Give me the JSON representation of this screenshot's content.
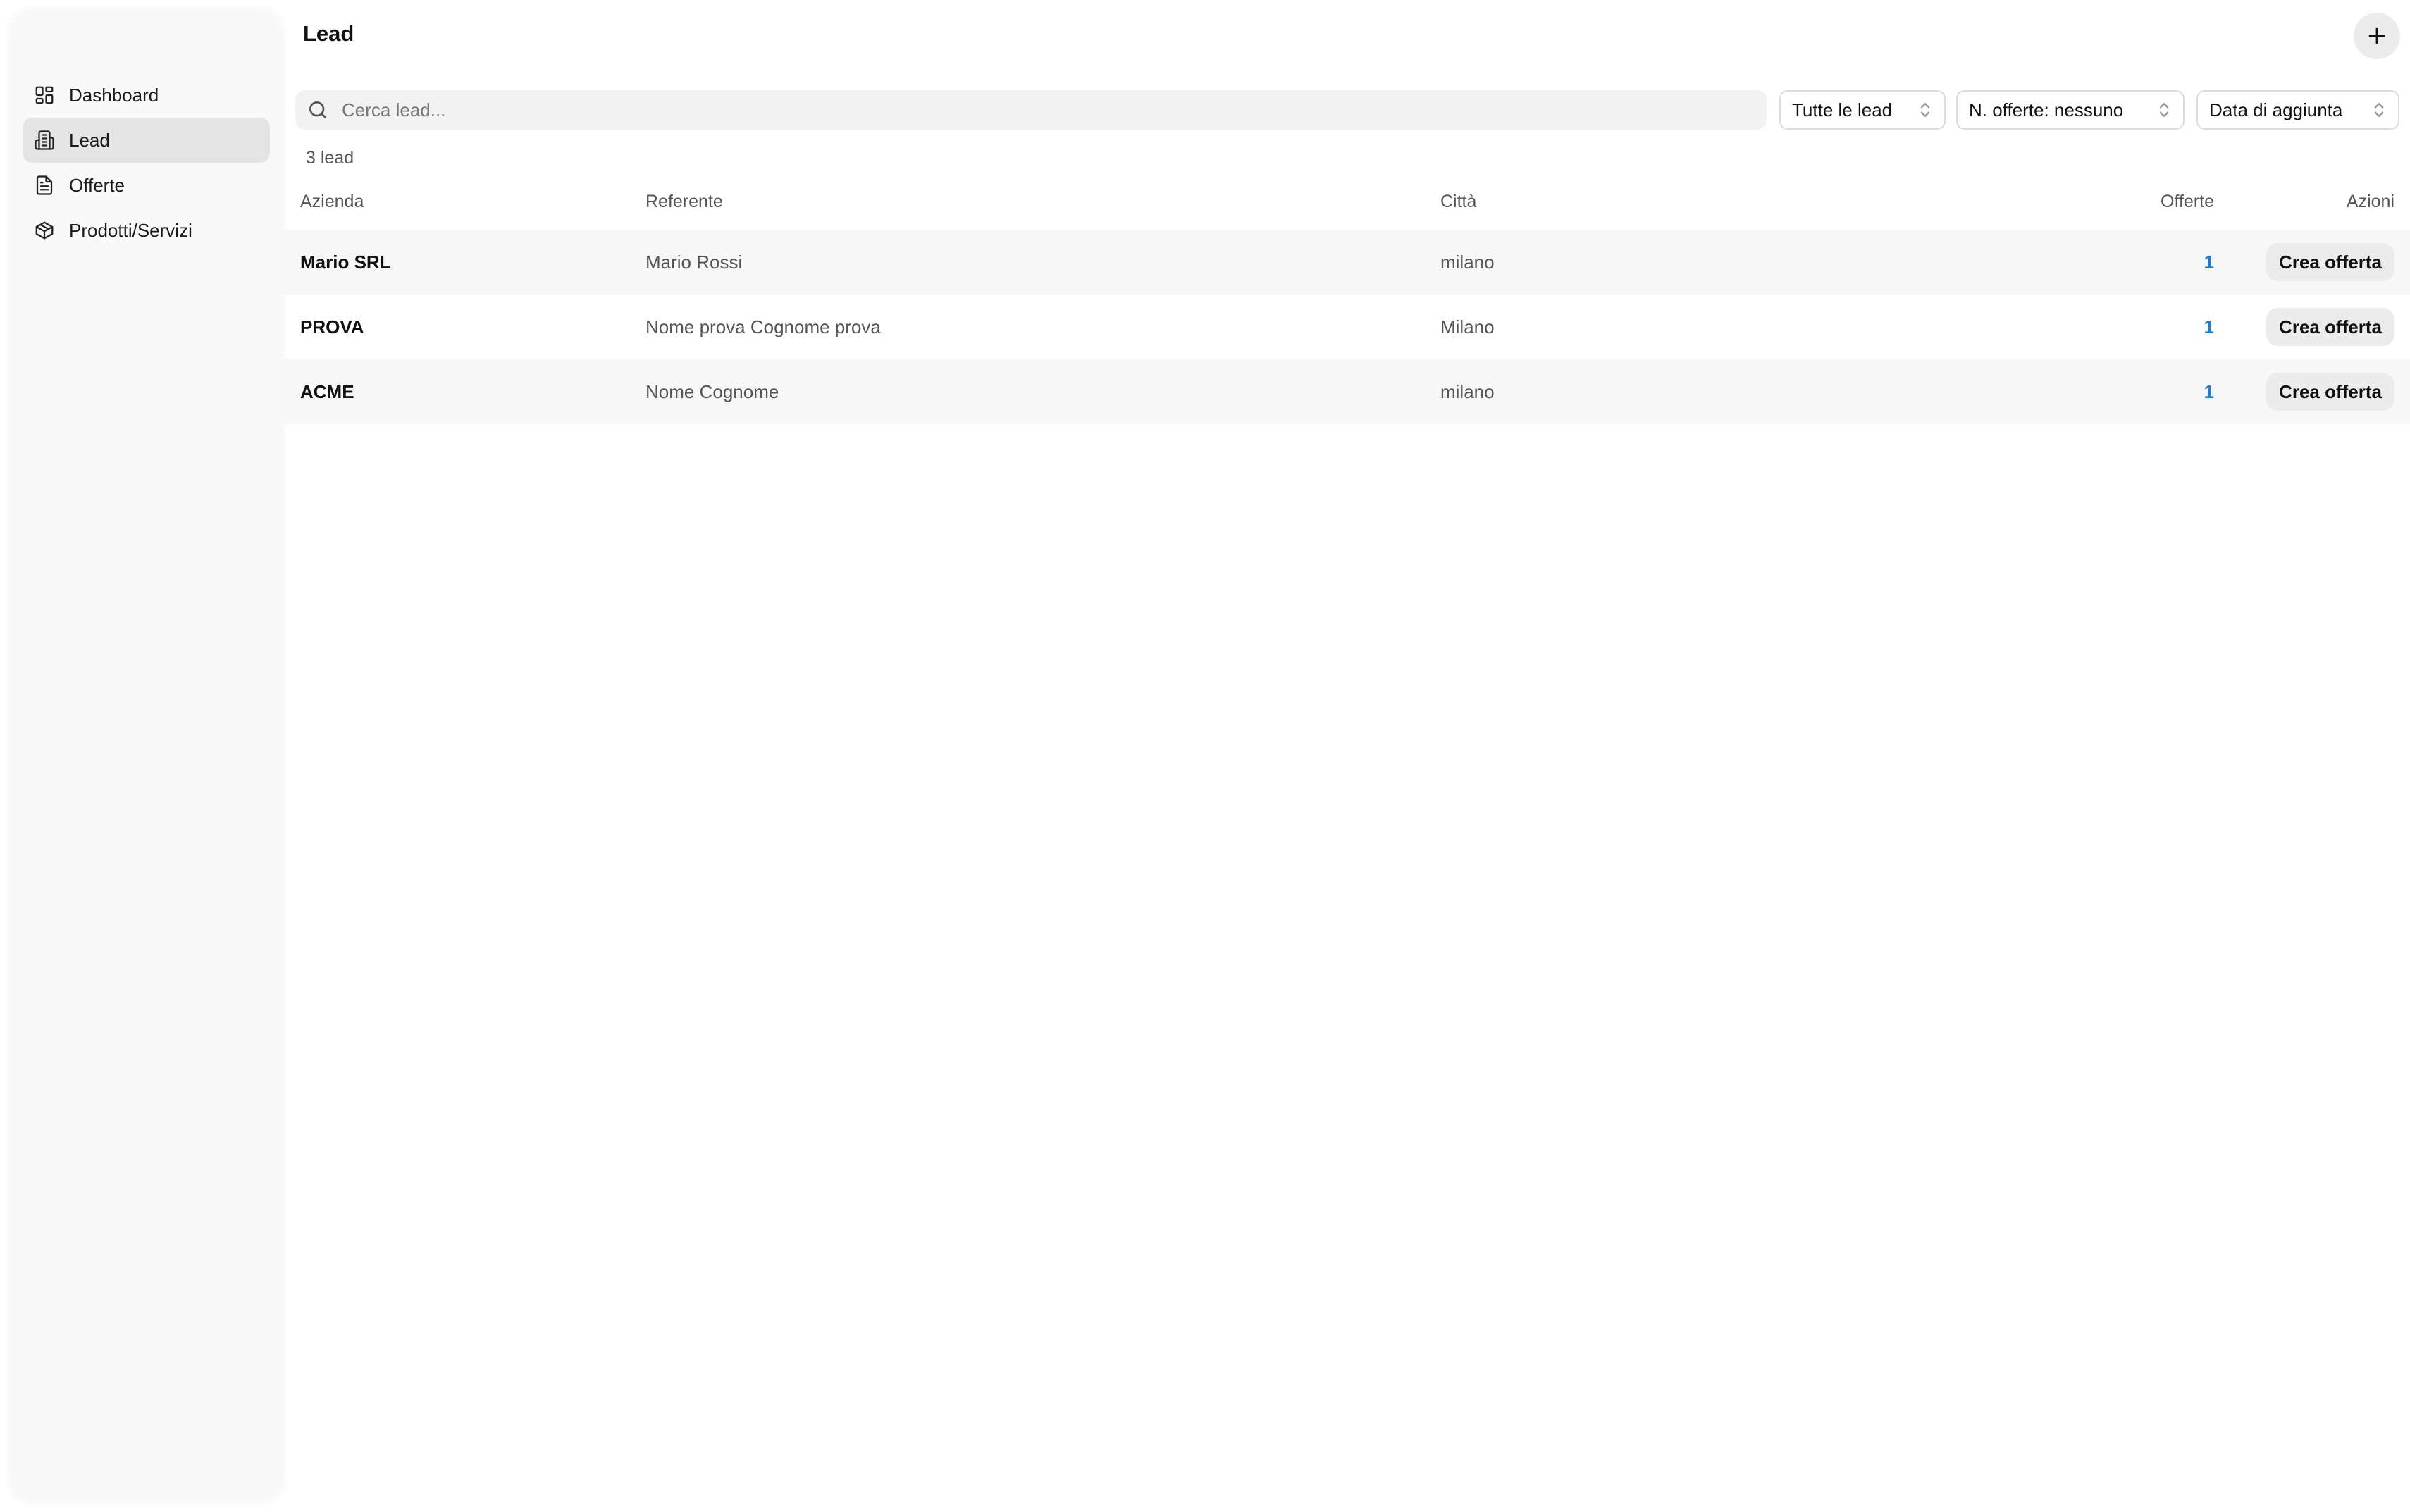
{
  "sidebar": {
    "items": [
      {
        "label": "Dashboard",
        "icon": "dashboard-icon"
      },
      {
        "label": "Lead",
        "icon": "building-icon",
        "active": true
      },
      {
        "label": "Offerte",
        "icon": "document-icon"
      },
      {
        "label": "Prodotti/Servizi",
        "icon": "package-icon"
      }
    ]
  },
  "header": {
    "title": "Lead",
    "add_icon": "plus-icon"
  },
  "toolbar": {
    "search_placeholder": "Cerca lead...",
    "filter_status": "Tutte le lead",
    "filter_offers": "N. offerte: nessuno",
    "sort": "Data di aggiunta"
  },
  "count_label": "3 lead",
  "table": {
    "columns": {
      "azienda": "Azienda",
      "referente": "Referente",
      "citta": "Città",
      "offerte": "Offerte",
      "azioni": "Azioni"
    },
    "rows": [
      {
        "azienda": "Mario SRL",
        "referente": "Mario Rossi",
        "citta": "milano",
        "offerte": "1",
        "action": "Crea offerta"
      },
      {
        "azienda": "PROVA",
        "referente": "Nome prova Cognome prova",
        "citta": "Milano",
        "offerte": "1",
        "action": "Crea offerta"
      },
      {
        "azienda": "ACME",
        "referente": "Nome Cognome",
        "citta": "milano",
        "offerte": "1",
        "action": "Crea offerta"
      }
    ]
  },
  "colors": {
    "link": "#1a7fd4",
    "active_nav": "#e4e4e4",
    "sidebar_bg": "#f9f9f9"
  }
}
